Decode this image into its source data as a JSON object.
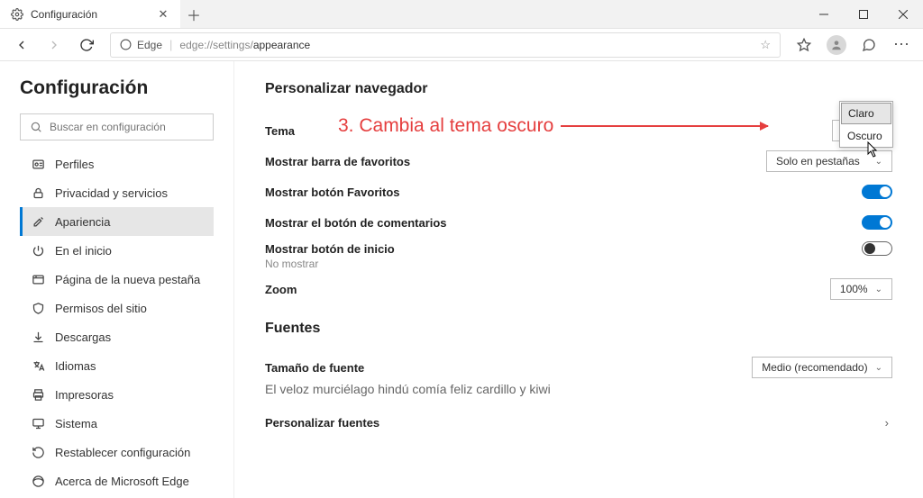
{
  "window": {
    "tab_title": "Configuración",
    "url_host": "Edge",
    "url_path_prefix": "edge://settings/",
    "url_path_bold": "appearance"
  },
  "sidebar": {
    "heading": "Configuración",
    "search_placeholder": "Buscar en configuración",
    "items": [
      {
        "label": "Perfiles",
        "icon": "user"
      },
      {
        "label": "Privacidad y servicios",
        "icon": "lock"
      },
      {
        "label": "Apariencia",
        "icon": "brush",
        "active": true
      },
      {
        "label": "En el inicio",
        "icon": "power"
      },
      {
        "label": "Página de la nueva pestaña",
        "icon": "newtab"
      },
      {
        "label": "Permisos del sitio",
        "icon": "shield"
      },
      {
        "label": "Descargas",
        "icon": "download"
      },
      {
        "label": "Idiomas",
        "icon": "language"
      },
      {
        "label": "Impresoras",
        "icon": "printer"
      },
      {
        "label": "Sistema",
        "icon": "system"
      },
      {
        "label": "Restablecer configuración",
        "icon": "reset"
      },
      {
        "label": "Acerca de Microsoft Edge",
        "icon": "edge"
      }
    ]
  },
  "main": {
    "section1_title": "Personalizar navegador",
    "theme_label": "Tema",
    "theme_value": "Claro",
    "theme_options": [
      "Claro",
      "Oscuro"
    ],
    "favbar_label": "Mostrar barra de favoritos",
    "favbar_value": "Solo en pestañas",
    "favbtn_label": "Mostrar botón Favoritos",
    "feedback_label": "Mostrar el botón de comentarios",
    "homebtn_label": "Mostrar botón de inicio",
    "homebtn_sub": "No mostrar",
    "zoom_label": "Zoom",
    "zoom_value": "100%",
    "section2_title": "Fuentes",
    "fontsize_label": "Tamaño de fuente",
    "fontsize_value": "Medio (recomendado)",
    "fontsample": "El veloz murciélago hindú comía feliz cardillo y kiwi",
    "customfonts_label": "Personalizar fuentes"
  },
  "annotation": {
    "text": "3. Cambia al tema oscuro"
  }
}
